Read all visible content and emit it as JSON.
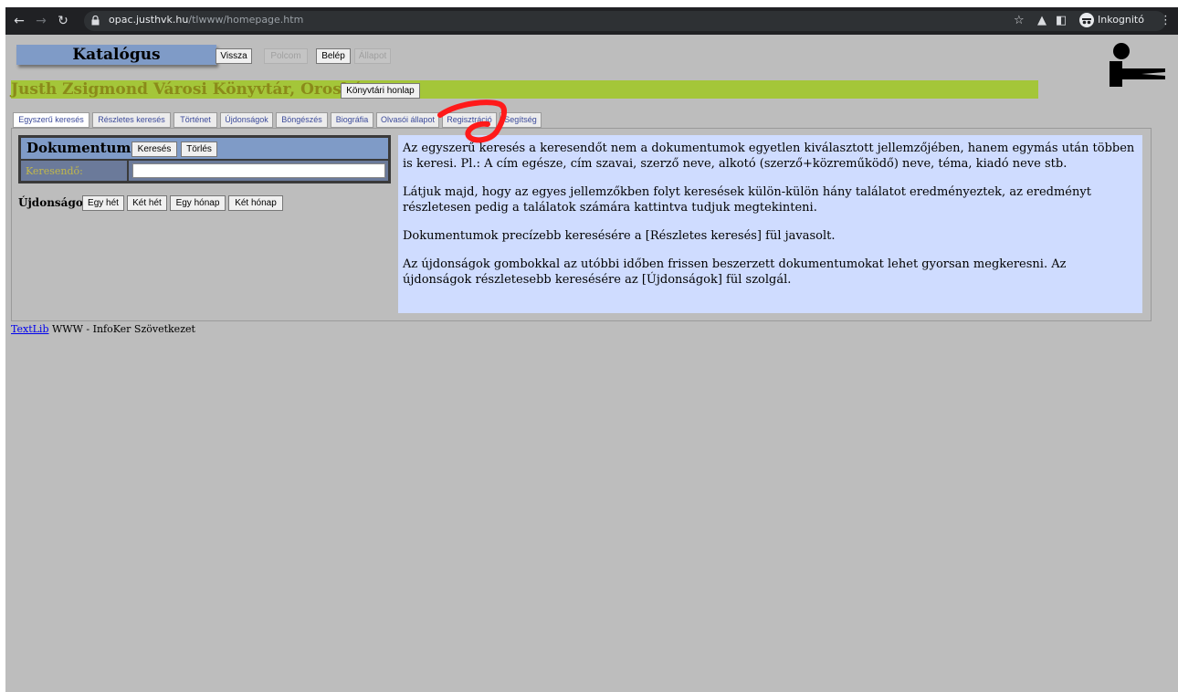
{
  "browser": {
    "url_host": "opac.justhvk.hu",
    "url_path": "/tlwww/homepage.htm",
    "incognito_label": "Inkognitó"
  },
  "header": {
    "catalog_title": "Katalógus",
    "buttons": {
      "back": "Vissza",
      "shelf": "Polcom",
      "login": "Belép",
      "status": "Állapot"
    },
    "library_name": "Justh Zsigmond Városi Könyvtár, Orosháza",
    "library_homepage_button": "Könyvtári honlap"
  },
  "tabs": [
    {
      "label": "Egyszerű keresés",
      "active": true
    },
    {
      "label": "Részletes keresés",
      "active": false
    },
    {
      "label": "Történet",
      "active": false
    },
    {
      "label": "Újdonságok",
      "active": false
    },
    {
      "label": "Böngészés",
      "active": false
    },
    {
      "label": "Biográfia",
      "active": false
    },
    {
      "label": "Olvasói állapot",
      "active": false
    },
    {
      "label": "Regisztráció",
      "active": false
    },
    {
      "label": "Segítség",
      "active": false
    }
  ],
  "search": {
    "heading": "Dokumentumok",
    "search_button": "Keresés",
    "clear_button": "Törlés",
    "field_label": "Keresendő:",
    "field_value": ""
  },
  "news": {
    "label": "Újdonságok:",
    "buttons": [
      "Egy hét",
      "Két hét",
      "Egy hónap",
      "Két hónap"
    ]
  },
  "help": {
    "paragraphs": [
      "Az egyszerű keresés a keresendőt nem a dokumentumok egyetlen kiválasztott jellemzőjében, hanem egymás után többen is keresi. Pl.: A cím egésze, cím szavai, szerző neve, alkotó (szerző+közreműködő) neve, téma, kiadó neve stb.",
      "Látjuk majd, hogy az egyes jellemzőkben folyt keresések külön-külön hány találatot eredményeztek, az eredményt részletesen pedig a találatok számára kattintva tudjuk megtekinteni.",
      "Dokumentumok precízebb keresésére a [Részletes keresés] fül javasolt.",
      "Az újdonságok gombokkal az utóbbi időben frissen beszerzett dokumentumokat lehet gyorsan megkeresni. Az újdonságok részletesebb keresésére az [Újdonságok] fül szolgál."
    ]
  },
  "footer": {
    "link": "TextLib",
    "text": " WWW - InfoKer Szövetkezet"
  },
  "colors": {
    "banner_green": "#a4c639",
    "panel_blue": "#7f9bc7",
    "help_bg": "#cfdcff",
    "annotation_red": "#ff0000"
  }
}
